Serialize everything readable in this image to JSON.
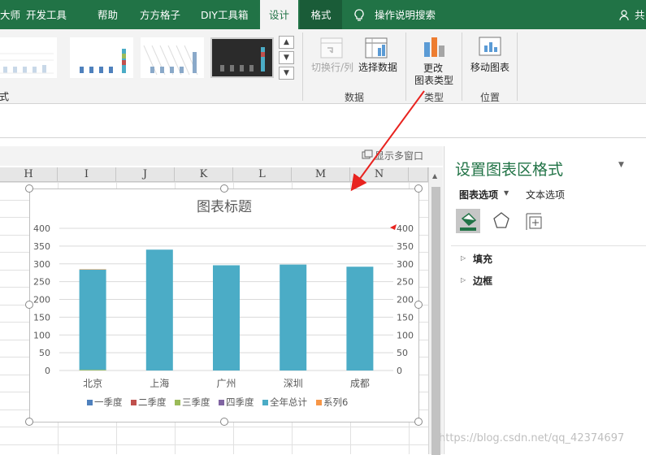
{
  "ribbon": {
    "tabs": [
      {
        "label": "大师",
        "active": false
      },
      {
        "label": "开发工具",
        "active": false
      },
      {
        "label": "帮助",
        "active": false
      },
      {
        "label": "方方格子",
        "active": false
      },
      {
        "label": "DIY工具箱",
        "active": false
      },
      {
        "label": "设计",
        "active": true
      },
      {
        "label": "格式",
        "active": false
      }
    ],
    "tell_me": "操作说明搜索",
    "share": "共",
    "style_group_label_partial": "式",
    "buttons": {
      "switch_row_col": "切换行/列",
      "select_data": "选择数据",
      "change_type_line1": "更改",
      "change_type_line2": "图表类型",
      "move_chart": "移动图表"
    },
    "groups": {
      "data": "数据",
      "type": "类型",
      "location": "位置"
    }
  },
  "sheet": {
    "show_windows": "显示多窗口",
    "columns": [
      "H",
      "I",
      "J",
      "K",
      "L",
      "M",
      "N"
    ]
  },
  "chart": {
    "title": "图表标题",
    "accent": "#4bacc6",
    "legend": [
      {
        "name": "一季度",
        "color": "#4f81bd"
      },
      {
        "name": "二季度",
        "color": "#c0504d"
      },
      {
        "name": "三季度",
        "color": "#9bbb59"
      },
      {
        "name": "四季度",
        "color": "#8064a2"
      },
      {
        "name": "全年总计",
        "color": "#4bacc6"
      },
      {
        "name": "系列6",
        "color": "#f79646"
      }
    ]
  },
  "chart_data": {
    "type": "bar",
    "title": "图表标题",
    "categories": [
      "北京",
      "上海",
      "广州",
      "深圳",
      "成都"
    ],
    "series": [
      {
        "name": "一季度",
        "values": [
          0,
          0,
          0,
          0,
          0
        ]
      },
      {
        "name": "二季度",
        "values": [
          0,
          0,
          0,
          0,
          0
        ]
      },
      {
        "name": "三季度",
        "values": [
          2,
          0,
          0,
          0,
          0
        ]
      },
      {
        "name": "四季度",
        "values": [
          0,
          0,
          0,
          0,
          0
        ]
      },
      {
        "name": "全年总计",
        "values": [
          282,
          340,
          296,
          298,
          292
        ]
      },
      {
        "name": "系列6",
        "values": [
          1,
          0,
          0,
          0,
          0
        ]
      }
    ],
    "ylim": [
      0,
      400
    ],
    "y_ticks": [
      "0",
      "50",
      "100",
      "150",
      "200",
      "250",
      "300",
      "350",
      "400"
    ],
    "y2_ticks": [
      "0",
      "50",
      "100",
      "150",
      "200",
      "250",
      "300",
      "350",
      "400"
    ],
    "stacked": true,
    "grid": true,
    "legend_position": "bottom"
  },
  "pane": {
    "title": "设置图表区格式",
    "tab_chart_options": "图表选项",
    "tab_text_options": "文本选项",
    "sections": [
      "填充",
      "边框"
    ]
  },
  "watermark": "https://blog.csdn.net/qq_42374697"
}
